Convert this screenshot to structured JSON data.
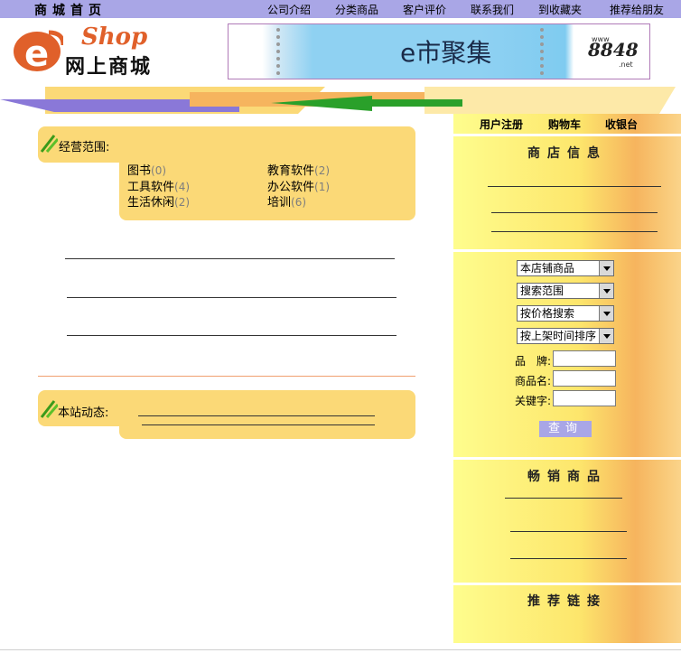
{
  "nav": {
    "home_title": "商城首页",
    "links": [
      "公司介绍",
      "分类商品",
      "客户评价",
      "联系我们",
      "到收藏夹",
      "推荐给朋友"
    ]
  },
  "logo": {
    "shop_text": "Shop",
    "cn_text": "网上商城",
    "e_letter": "e"
  },
  "banner": {
    "title": "e市聚集",
    "logo_text": "8848",
    "logo_sub": "www",
    "logo_suffix": ".net"
  },
  "scope": {
    "title": "经营范围:",
    "categories": [
      {
        "name": "图书",
        "count": "(0)"
      },
      {
        "name": "教育软件",
        "count": "(2)"
      },
      {
        "name": "工具软件",
        "count": "(4)"
      },
      {
        "name": "办公软件",
        "count": "(1)"
      },
      {
        "name": "生活休闲",
        "count": "(2)"
      },
      {
        "name": "培训",
        "count": "(6)"
      }
    ]
  },
  "news": {
    "title": "本站动态:"
  },
  "right": {
    "top_links": [
      "用户注册",
      "购物车",
      "收银台"
    ],
    "shop_info_title": "商店信息",
    "search": {
      "selects": [
        "本店铺商品",
        "搜索范围",
        "按价格搜索",
        "按上架时间排序"
      ],
      "fields": [
        {
          "label": "品　牌:",
          "value": ""
        },
        {
          "label": "商品名:",
          "value": ""
        },
        {
          "label": "关键字:",
          "value": ""
        }
      ],
      "button": "查询"
    },
    "bestseller_title": "畅销商品",
    "links_title": "推荐链接"
  },
  "colors": {
    "nav_bg": "#a9a6e6",
    "panel_yellow": "#fbd977",
    "logo_orange": "#e0602a"
  }
}
